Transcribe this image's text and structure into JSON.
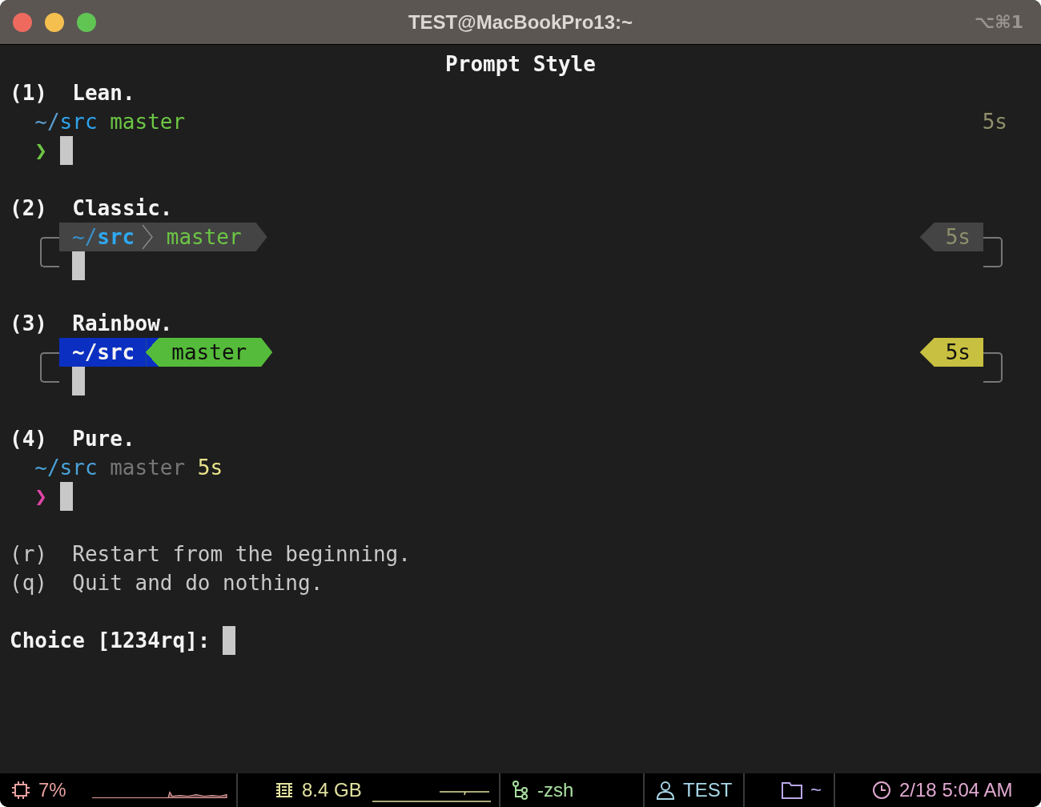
{
  "window": {
    "title": "TEST@MacBookPro13:~",
    "shortcut": "⌥⌘1"
  },
  "heading": "Prompt Style",
  "options": [
    {
      "kind": "lean",
      "number": "(1)",
      "name": "Lean.",
      "dir_prefix": "~/",
      "dir": "src",
      "branch": "master",
      "duration": "5s",
      "prompt_char": "❯"
    },
    {
      "kind": "classic",
      "number": "(2)",
      "name": "Classic.",
      "dir_prefix": "~/",
      "dir": "src",
      "branch": "master",
      "duration": "5s"
    },
    {
      "kind": "rainbow",
      "number": "(3)",
      "name": "Rainbow.",
      "dir_prefix": "~/",
      "dir": "src",
      "branch": "master",
      "duration": "5s"
    },
    {
      "kind": "pure",
      "number": "(4)",
      "name": "Pure.",
      "dir_prefix": "~/",
      "dir": "src",
      "branch": "master",
      "duration": "5s",
      "prompt_char": "❯"
    }
  ],
  "actions": [
    {
      "key": "(r)",
      "text": "Restart from the beginning."
    },
    {
      "key": "(q)",
      "text": "Quit and do nothing."
    }
  ],
  "choice": {
    "label": "Choice [1234rq]:"
  },
  "status_bar": [
    {
      "kind": "cpu",
      "text": "7%",
      "color": "#e8a0a0"
    },
    {
      "kind": "memory",
      "text": "8.4 GB",
      "color": "#e2e2a0"
    },
    {
      "kind": "process",
      "text": "-zsh",
      "color": "#a8e0a0"
    },
    {
      "kind": "user",
      "text": "TEST",
      "color": "#a8d8e8"
    },
    {
      "kind": "folder",
      "text": "~",
      "color": "#b8a8e8"
    },
    {
      "kind": "clock",
      "text": "2/18 5:04 AM",
      "color": "#e0a8d0"
    }
  ]
}
